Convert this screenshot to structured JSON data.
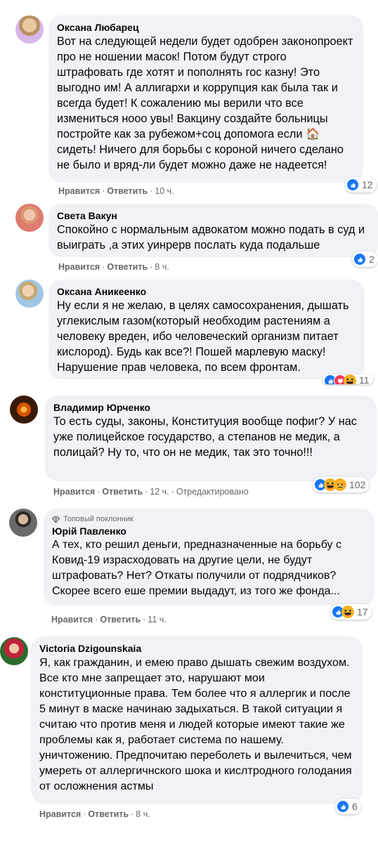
{
  "comments": [
    {
      "author": "Оксана Любарец",
      "text": "Вот на следующей недели будет одобрен законопроект про не ношении масок! Потом будут строго штрафовать где хотят и пополнять гос казну! Это выгодно им! А аллигархи и коррупция как была так и всегда будет! К сожалению мы верили что все измениться нооо увы! Вакцину создайте больницы постройте как за рубежом+соц допомога если 🏠 сидеть! Ничего для борьбы с короной ничего сделано не было и вряд-ли будет можно даже не надеется!",
      "like_label": "Нравится",
      "reply_label": "Ответить",
      "time": "10 ч.",
      "reaction_count": "12"
    },
    {
      "author": "Света Вакун",
      "text": "Спокойно с нормальным адвокатом можно подать в суд и выиграть ,а этих уинрерв послать куда подальше",
      "like_label": "Нравится",
      "reply_label": "Ответить",
      "time": "8 ч.",
      "reaction_count": "2"
    },
    {
      "author": "Оксана Аникеенко",
      "text": "Ну если я не желаю, в целях самосохранения, дышать углекислым газом(который необходим растениям а человеку вреден, ибо человеческий организм питает кислород). Будь как все?! Пошей марлевую маску! Нарушение прав человека, по всем фронтам.",
      "like_label": "Нравится",
      "reply_label": "Ответить",
      "time": "8 ч.",
      "reaction_count": "11"
    },
    {
      "author": "Владимир Юрченко",
      "text": "То есть суды, законы, Конституция вообще пофиг? У нас уже полицейское государство, а степанов не медик, а полицай? Ну то, что он не медик, так это точно!!!",
      "like_label": "Нравится",
      "reply_label": "Ответить",
      "time": "12 ч.",
      "edited_label": "Отредактировано",
      "reaction_count": "102"
    },
    {
      "badge": "Топовый поклонник",
      "author": "Юрій Павленко",
      "text": "А тех, кто решил деньги, предназначенные на борьбу с Ковид-19 израсходовать на другие цели, не будут штрафовать? Нет? Откаты получили от подрядчиков? Скорее всего еше премии выдадут, из того же фонда...",
      "like_label": "Нравится",
      "reply_label": "Ответить",
      "time": "11 ч.",
      "reaction_count": "17"
    },
    {
      "author": "Victoria Dzigounskaia",
      "text": "Я, как гражданин, и емею право дышать свежим воздухом. Все кто мне запрещает это, нарушают мои конституционные права. Тем более что я аллергик и после 5 минут в маске начинаю задыхаться. В такой ситуации я считаю что против меня и людей которые имеют такие же проблемы как я, работает система по нашему. уничтожению. Предпочитаю переболеть и вылечиться, чем умереть от аллергичнского шока и кислтродного голодания от осложнения астмы",
      "like_label": "Нравится",
      "reply_label": "Ответить",
      "time": "8 ч.",
      "reaction_count": "6"
    }
  ],
  "colors": {
    "bubble": "#f0f2f5",
    "meta_text": "#65676b",
    "like_blue": "#1877f2",
    "haha_yellow": "#f7b125",
    "love_red": "#f33e58"
  },
  "icons": [
    "like-icon",
    "haha-icon",
    "sad-icon",
    "love-icon",
    "diamond-badge-icon"
  ]
}
